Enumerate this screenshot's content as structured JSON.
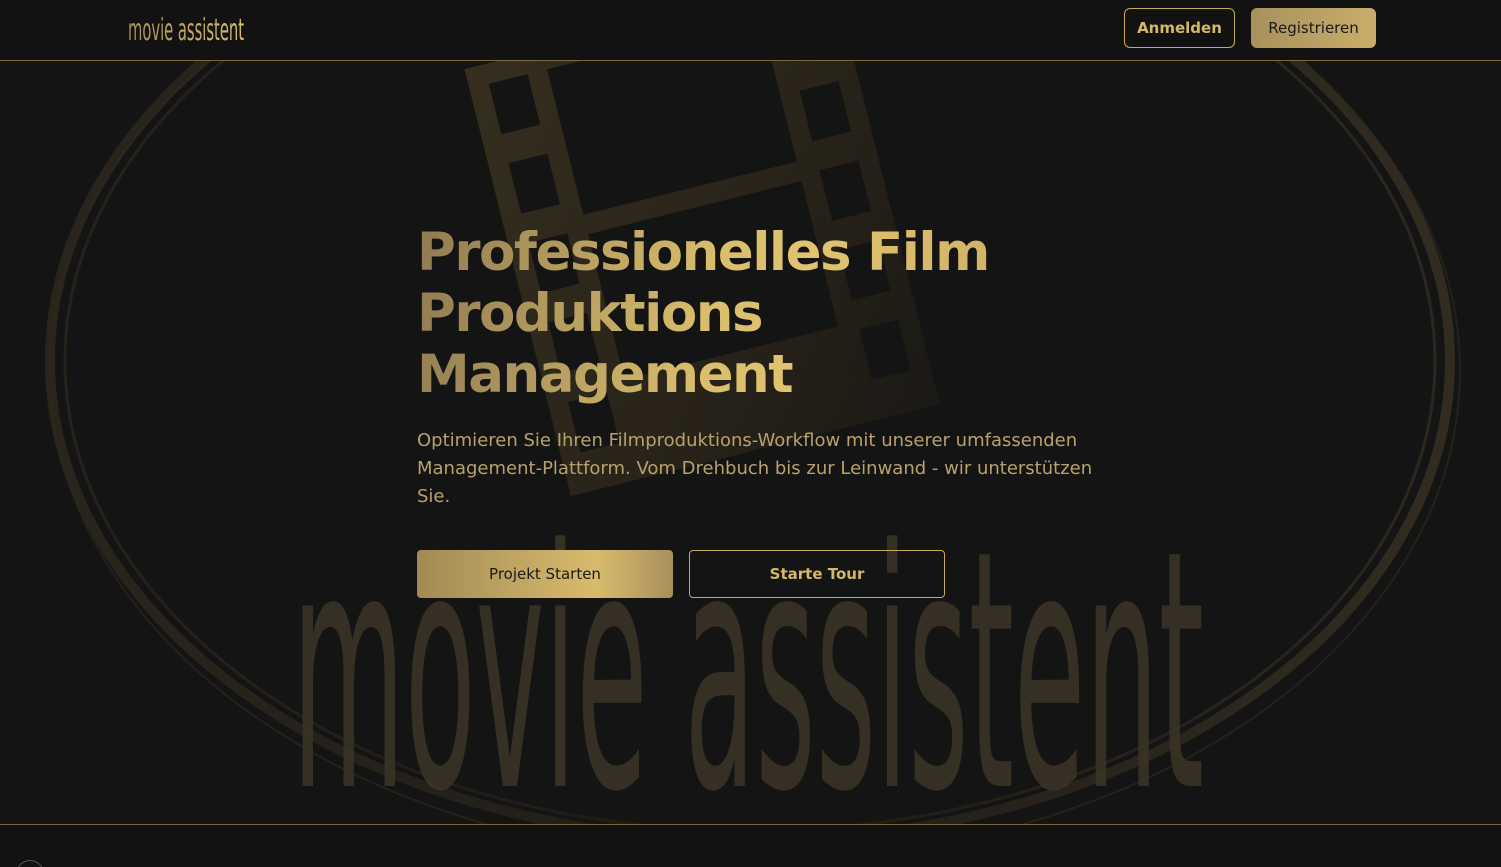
{
  "header": {
    "logo_text": "movie assistent",
    "login_label": "Anmelden",
    "register_label": "Registrieren"
  },
  "hero": {
    "title_lines": [
      "Professionelles Film",
      "Produktions",
      "Management"
    ],
    "subtitle": "Optimieren Sie Ihren Filmproduktions-Workflow mit unserer umfassenden Management-Plattform. Vom Drehbuch bis zur Leinwand - wir unterstützen Sie.",
    "primary_cta": "Projekt Starten",
    "secondary_cta": "Starte Tour",
    "watermark_text": "movie assistent"
  },
  "colors": {
    "background": "#141414",
    "accent_gold": "#d4b866",
    "rule": "#7a6a3e"
  },
  "icons": {
    "background_art": "film-reel-icon"
  }
}
